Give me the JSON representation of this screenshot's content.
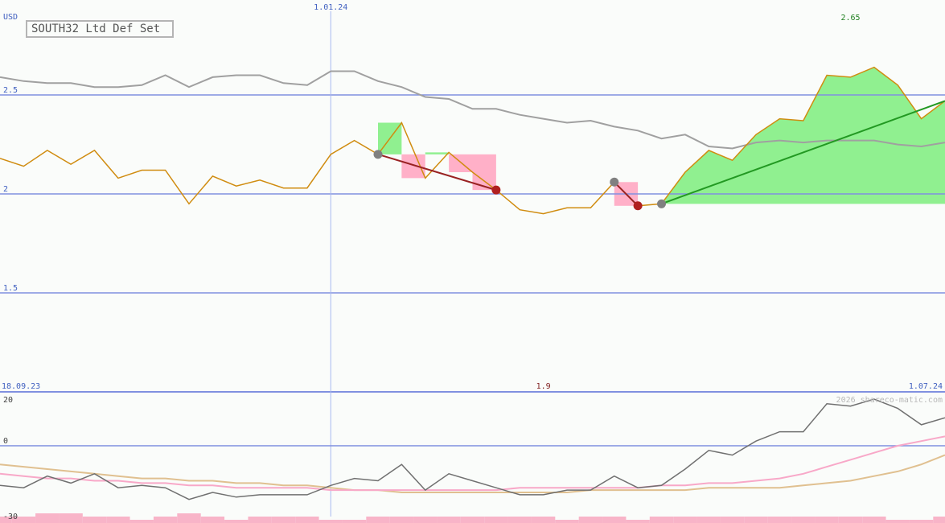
{
  "chart": {
    "title": "SOUTH32 Ltd Def Set",
    "currency": "USD",
    "date_start": "18.09.23",
    "date_end": "1.07.24",
    "date_marker": "1.01.24",
    "high_label": "2.65",
    "low_label": "1.9",
    "watermark": "2026 shareco-matic.com",
    "colors": {
      "price": "#d08c10",
      "ma_long": "#a0a0a0",
      "grid": "#8090e0",
      "gain": "#90f090",
      "loss": "#ffb0c8",
      "trend_up": "#229922",
      "trend_down": "#992222"
    }
  },
  "chart_data": [
    {
      "type": "line",
      "y_ticks": [
        "2.5",
        "2",
        "1.5"
      ],
      "ylim": [
        1.0,
        2.98
      ],
      "series": [
        {
          "values": [
            2.18,
            2.14,
            2.22,
            2.15,
            2.22,
            2.08,
            2.12,
            2.12,
            1.95,
            2.09,
            2.04,
            2.07,
            2.03,
            2.03,
            2.2,
            2.27,
            2.2,
            2.36,
            2.08,
            2.21,
            2.11,
            2.02,
            1.92,
            1.9,
            1.93,
            1.93,
            2.06,
            1.94,
            1.95,
            2.11,
            2.22,
            2.17,
            2.3,
            2.38,
            2.37,
            2.6,
            2.59,
            2.64,
            2.55,
            2.38,
            2.47
          ]
        },
        {
          "values": [
            2.59,
            2.57,
            2.56,
            2.56,
            2.54,
            2.54,
            2.55,
            2.6,
            2.54,
            2.59,
            2.6,
            2.6,
            2.56,
            2.55,
            2.62,
            2.62,
            2.57,
            2.54,
            2.49,
            2.48,
            2.43,
            2.43,
            2.4,
            2.38,
            2.36,
            2.37,
            2.34,
            2.32,
            2.28,
            2.3,
            2.24,
            2.23,
            2.26,
            2.27,
            2.26,
            2.27,
            2.27,
            2.27,
            2.25,
            2.24,
            2.26
          ]
        }
      ],
      "signals": [
        {
          "from": 16,
          "to": 21,
          "direction": "down"
        },
        {
          "from": 26,
          "to": 27,
          "direction": "down"
        },
        {
          "from": 28,
          "to": 40,
          "direction": "up"
        }
      ]
    },
    {
      "type": "line",
      "y_ticks": [
        "20",
        "0",
        "-30"
      ],
      "ylim": [
        -30,
        20
      ],
      "series": [
        {
          "values": [
            -17,
            -18,
            -13,
            -16,
            -12,
            -18,
            -17,
            -18,
            -23,
            -20,
            -22,
            -21,
            -21,
            -21,
            -17,
            -14,
            -15,
            -8,
            -19,
            -12,
            -15,
            -18,
            -21,
            -21,
            -19,
            -19,
            -13,
            -18,
            -17,
            -10,
            -2,
            -4,
            2,
            6,
            6,
            18,
            17,
            20,
            16,
            9,
            12
          ]
        },
        {
          "values": [
            -12,
            -13,
            -14,
            -14,
            -15,
            -15,
            -16,
            -16,
            -17,
            -17,
            -18,
            -18,
            -18,
            -18,
            -19,
            -19,
            -19,
            -19,
            -19,
            -19,
            -19,
            -19,
            -18,
            -18,
            -18,
            -18,
            -18,
            -18,
            -17,
            -17,
            -16,
            -16,
            -15,
            -14,
            -12,
            -9,
            -6,
            -3,
            0,
            2,
            4
          ]
        },
        {
          "values": [
            -8,
            -9,
            -10,
            -11,
            -12,
            -13,
            -14,
            -14,
            -15,
            -15,
            -16,
            -16,
            -17,
            -17,
            -18,
            -19,
            -19,
            -20,
            -20,
            -20,
            -20,
            -20,
            -20,
            -20,
            -20,
            -19,
            -19,
            -19,
            -19,
            -19,
            -18,
            -18,
            -18,
            -18,
            -17,
            -16,
            -15,
            -13,
            -11,
            -8,
            -4
          ]
        }
      ],
      "bars": [
        2,
        2,
        3,
        3,
        2,
        2,
        1,
        2,
        3,
        2,
        1,
        2,
        2,
        2,
        1,
        1,
        2,
        2,
        2,
        2,
        2,
        2,
        2,
        2,
        1,
        2,
        2,
        1,
        2,
        2,
        2,
        2,
        2,
        2,
        2,
        2,
        2,
        2,
        1,
        1,
        2
      ]
    }
  ]
}
